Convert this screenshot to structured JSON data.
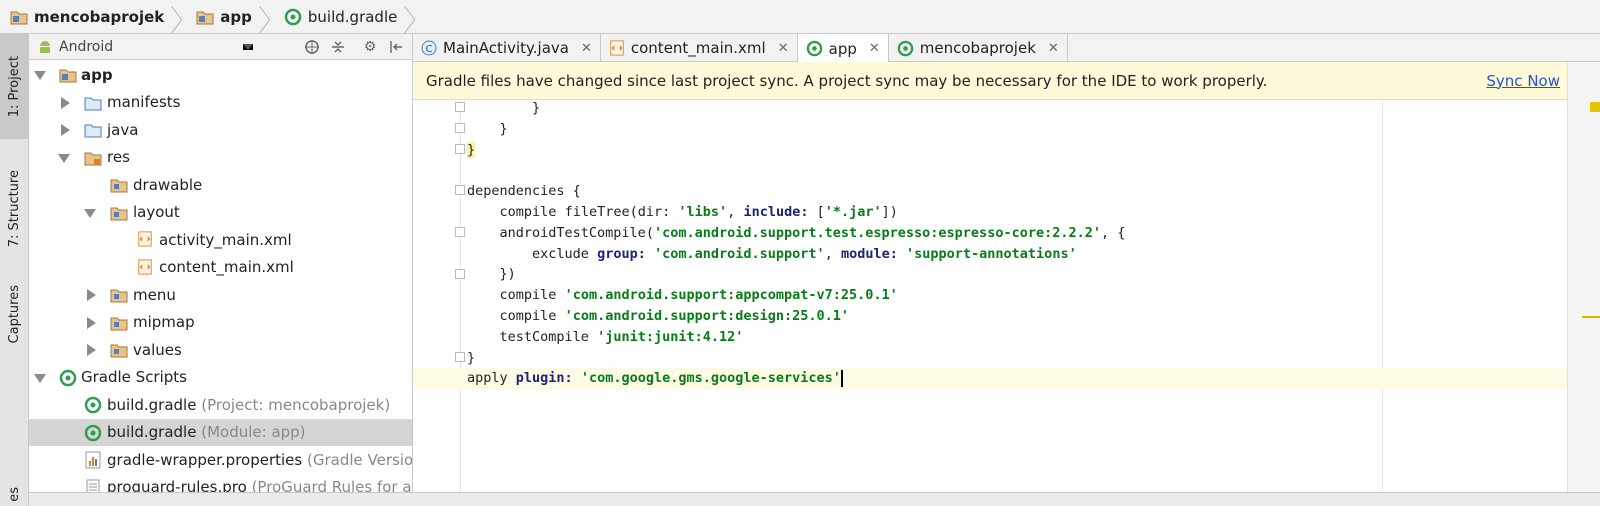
{
  "breadcrumb": {
    "items": [
      {
        "label": "mencobaprojek",
        "icon": "folder-module-icon"
      },
      {
        "label": "app",
        "icon": "folder-module-icon"
      },
      {
        "label": "build.gradle",
        "icon": "gradle-icon"
      }
    ]
  },
  "tool_strip": {
    "tabs": [
      {
        "label": "1: Project",
        "active": true
      },
      {
        "label": "7: Structure",
        "active": false
      },
      {
        "label": "Captures",
        "active": false
      },
      {
        "label": "es",
        "active": false
      }
    ]
  },
  "project_panel": {
    "view_selector": "Android",
    "toolbar_icons": [
      "target-icon",
      "collapse-icon",
      "gear-icon",
      "hide-icon"
    ],
    "tree": [
      {
        "label": "app",
        "icon": "folder-module-icon",
        "bold": true
      },
      {
        "label": "manifests",
        "icon": "folder-icon"
      },
      {
        "label": "java",
        "icon": "folder-icon"
      },
      {
        "label": "res",
        "icon": "folder-res-icon"
      },
      {
        "label": "drawable",
        "icon": "folder-icon"
      },
      {
        "label": "layout",
        "icon": "folder-icon"
      },
      {
        "label": "activity_main.xml",
        "icon": "xml-file-icon"
      },
      {
        "label": "content_main.xml",
        "icon": "xml-file-icon"
      },
      {
        "label": "menu",
        "icon": "folder-icon"
      },
      {
        "label": "mipmap",
        "icon": "folder-icon"
      },
      {
        "label": "values",
        "icon": "folder-icon"
      },
      {
        "label": "Gradle Scripts",
        "icon": "gradle-icon"
      },
      {
        "label": "build.gradle",
        "suffix": "(Project: mencobaprojek)",
        "icon": "gradle-icon"
      },
      {
        "label": "build.gradle",
        "suffix": "(Module: app)",
        "icon": "gradle-icon",
        "selected": true
      },
      {
        "label": "gradle-wrapper.properties",
        "suffix": "(Gradle Version)",
        "icon": "properties-file-icon"
      },
      {
        "label": "proguard-rules.pro",
        "suffix": "(ProGuard Rules for app)",
        "icon": "text-file-icon"
      }
    ]
  },
  "editor_tabs": [
    {
      "label": "MainActivity.java",
      "icon": "java-class-icon",
      "active": false
    },
    {
      "label": "content_main.xml",
      "icon": "xml-file-icon",
      "active": false
    },
    {
      "label": "app",
      "icon": "gradle-icon",
      "active": true
    },
    {
      "label": "mencobaprojek",
      "icon": "gradle-icon",
      "active": false
    }
  ],
  "banner": {
    "message": "Gradle files have changed since last project sync. A project sync may be necessary for the IDE to work properly.",
    "action": "Sync Now"
  },
  "code": {
    "lines": [
      "        }",
      "    }",
      "}",
      "",
      "dependencies {",
      "    compile fileTree(dir: 'libs', include: ['*.jar'])",
      "    androidTestCompile('com.android.support.test.espresso:espresso-core:2.2.2', {",
      "        exclude group: 'com.android.support', module: 'support-annotations'",
      "    })",
      "    compile 'com.android.support:appcompat-v7:25.0.1'",
      "    compile 'com.android.support:design:25.0.1'",
      "    testCompile 'junit:junit:4.12'",
      "}",
      "apply plugin: 'com.google.gms.google-services'"
    ]
  },
  "colors": {
    "banner_bg": "#fdf9d9",
    "string_green": "#067d17",
    "keyword_navy": "#1a237e",
    "link_blue": "#2255cc",
    "selection_gray": "#d5d5d5"
  }
}
